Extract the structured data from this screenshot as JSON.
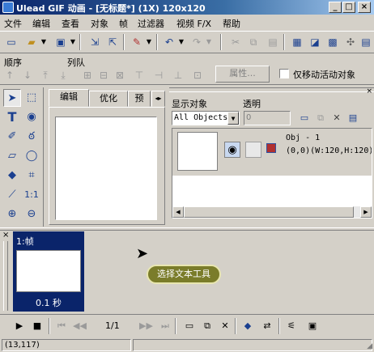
{
  "window": {
    "title": "Ulead GIF 动画 - [无标题*] (1X) 120x120",
    "min": "_",
    "max": "□",
    "close": "×"
  },
  "menu": [
    "文件",
    "编辑",
    "查看",
    "对象",
    "帧",
    "过滤器",
    "视频 F/X",
    "帮助"
  ],
  "toolbar": {
    "icons": [
      "new-icon",
      "open-icon",
      "save-icon",
      "import-icon",
      "export-icon",
      "paint-icon",
      "undo-icon",
      "redo-icon",
      "cut-icon",
      "copy-icon",
      "paste-icon",
      "optimize-icon",
      "preview-icon",
      "settings-icon"
    ]
  },
  "order_bar": {
    "order_label": "顺序",
    "queue_label": "列队",
    "properties_label": "属性...",
    "move_only_active_label": "仅移动活动对象"
  },
  "tools": [
    "pick-tool",
    "marquee-tool",
    "text-tool",
    "transform-tool",
    "brush-tool",
    "lasso-tool",
    "eraser-tool",
    "ellipse-tool",
    "fill-tool",
    "crop-tool",
    "eyedropper-tool",
    "one-to-one-tool",
    "zoom-in-tool",
    "zoom-out-tool"
  ],
  "tool_labels": {
    "one_to_one": "1:1"
  },
  "tabs": [
    "编辑",
    "优化",
    "预"
  ],
  "object_panel": {
    "show_objects_label": "显示对象",
    "opacity_label": "透明",
    "show_objects_value": "All Objects",
    "opacity_value": "0",
    "object": {
      "name": "Obj - 1",
      "info": "(0,0)(W:120,H:120)"
    }
  },
  "frames": [
    {
      "label": "1:帧",
      "delay": "0.1 秒"
    }
  ],
  "tooltip": "选择文本工具",
  "playback": {
    "counter": "1/1"
  },
  "status": {
    "coords": "(13,117)"
  }
}
